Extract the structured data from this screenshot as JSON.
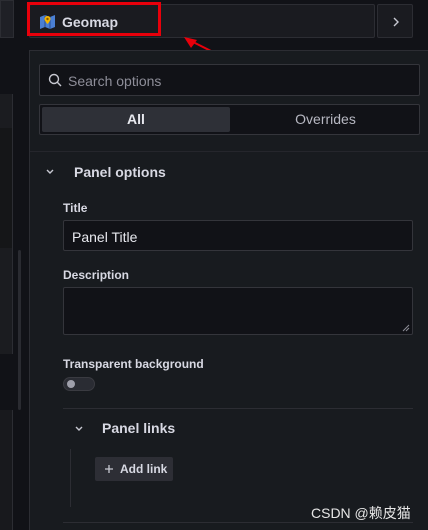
{
  "viz_picker": {
    "name": "Geomap"
  },
  "search": {
    "placeholder": "Search options"
  },
  "tabs": [
    {
      "label": "All",
      "active": true
    },
    {
      "label": "Overrides",
      "active": false
    }
  ],
  "panel_options": {
    "title": "Panel options",
    "title_field": {
      "label": "Title",
      "value": "Panel Title"
    },
    "description_field": {
      "label": "Description",
      "value": ""
    },
    "transparent_background": {
      "label": "Transparent background",
      "enabled": false
    },
    "panel_links": {
      "title": "Panel links",
      "add_link_label": "Add link"
    }
  },
  "watermark": "CSDN @赖皮猫",
  "colors": {
    "highlight": "#e8000b",
    "background": "#111217",
    "pane": "#181b1f"
  }
}
